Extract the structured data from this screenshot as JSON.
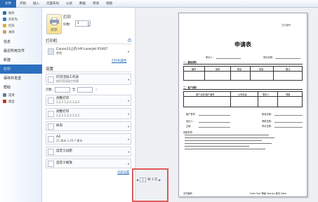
{
  "ribbon": {
    "tabs": [
      "文件",
      "开始",
      "插入",
      "页面布局",
      "公式",
      "数据",
      "审阅",
      "视图"
    ]
  },
  "nav": {
    "small_items": [
      {
        "label": "保存",
        "icon": "save-icon",
        "color": "#2a6cb8"
      },
      {
        "label": "另存为",
        "icon": "save-as-icon",
        "color": "#3a7bd0"
      },
      {
        "label": "打开",
        "icon": "open-folder-icon",
        "color": "#e0a93b"
      },
      {
        "label": "关闭",
        "icon": "close-doc-icon",
        "color": "#c9a45c"
      }
    ],
    "big_items": [
      "信息",
      "最近所用文件",
      "新建",
      "打印",
      "保存并发送",
      "帮助"
    ],
    "active": "打印",
    "bottom_items": [
      {
        "label": "选项",
        "icon": "options-icon",
        "color": "#5b7fa8"
      },
      {
        "label": "退出",
        "icon": "exit-icon",
        "color": "#c0392b"
      }
    ]
  },
  "print": {
    "button_label": "打印",
    "title": "打印",
    "copies_label": "份数:",
    "copies_value": "1",
    "printer_section": "打印机",
    "printer_name": "Canon23上的 HP LaserJet P1007",
    "printer_status": "就绪",
    "printer_properties_link": "打印机属性",
    "settings_section": "设置",
    "settings": [
      {
        "name": "print-what-dropdown",
        "line1": "打印活动工作表",
        "line2": "仅打印活动工作表"
      },
      {
        "name": "collate-dropdown",
        "line1": "调整打印",
        "line2": "1,2,3  1,2,3  1,2,3"
      },
      {
        "name": "orientation-dropdown",
        "line1": "纵向",
        "line2": ""
      },
      {
        "name": "paper-size-dropdown",
        "line1": "A4",
        "line2": "21 厘米 x 29.7 厘米"
      },
      {
        "name": "margins-dropdown",
        "line1": "自定义边距",
        "line2": ""
      },
      {
        "name": "scaling-dropdown",
        "line1": "自定义缩放",
        "line2": ""
      }
    ],
    "pages_label": "页数:",
    "pages_to": "至",
    "page_setup_link": "页面设置"
  },
  "preview": {
    "doc_title": "申请表",
    "fields": {
      "apply_person": "申请人:",
      "apply_date": "申请日期:",
      "section1": "一、基础资料",
      "col1": "编号",
      "col2": "品种",
      "col3": "数量",
      "col4": "用途",
      "col5": "备注",
      "section2": "二、客户资料",
      "cust_col1": "客户名称/客户编号",
      "cust_col2": "公司电话",
      "cust_col3": "联系人",
      "cust_col4": "规格",
      "sig1": "客户签章:",
      "sig2": "核准日期:",
      "sig3": "经办人:",
      "sig4": "审核日期:",
      "sig5": "主管:",
      "sig6": "申请日期:",
      "notes_title": "说明事项:",
      "footer_left": "文件编号:",
      "footer_right": "Form Sort 等级  Version 版本  Date"
    },
    "pager": {
      "current_page": "1",
      "total_text": "共 1 页",
      "prev": "◀",
      "next": "▶"
    }
  },
  "colors": {
    "accent": "#2a6cb8",
    "highlight_box": "#e05a5a"
  }
}
